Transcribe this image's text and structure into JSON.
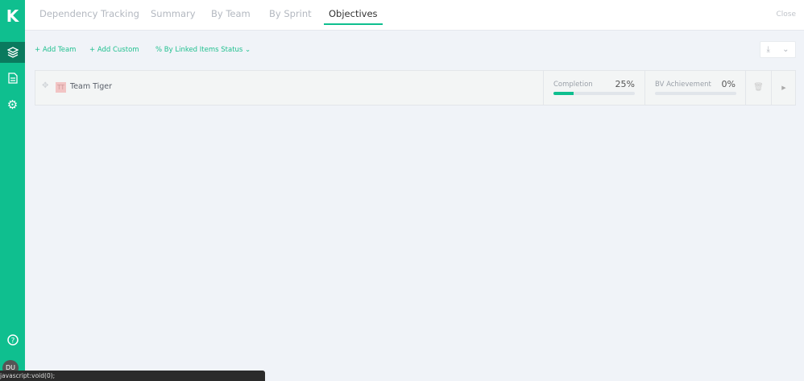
{
  "sidebar": {
    "logo": "K",
    "avatar": "DU"
  },
  "tabs": [
    "Dependency Tracking",
    "Summary",
    "By Team",
    "By Sprint",
    "Objectives"
  ],
  "close": "Close",
  "actions": {
    "add_team": "+ Add Team",
    "add_custom": "+ Add Custom",
    "mode": "% By Linked Items Status"
  },
  "team": {
    "initials": "TT",
    "name": "Team Tiger",
    "completion_label": "Completion",
    "completion": "25%",
    "completion_value": 25,
    "bv_label": "BV Achievement",
    "bv": "0%",
    "bv_value": 0
  },
  "statusbar": "javascript:void(0);"
}
